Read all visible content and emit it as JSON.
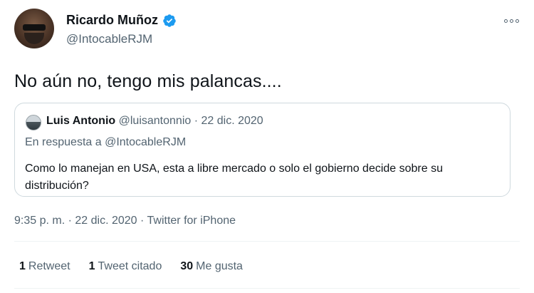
{
  "author": {
    "name": "Ricardo Muñoz",
    "handle": "@IntocableRJM",
    "verified": true
  },
  "tweet": {
    "text": "No aún no, tengo mis palancas...."
  },
  "quoted_tweet": {
    "author_name": "Luis Antonio",
    "author_handle": "@luisantonnio",
    "separator": "·",
    "date": "22 dic. 2020",
    "reply_prefix": "En respuesta a",
    "reply_to": "@IntocableRJM",
    "text": "Como lo manejan en USA, esta a libre mercado o solo el gobierno decide sobre su distribución?"
  },
  "meta": {
    "time": "9:35 p. m.",
    "separator": "·",
    "date": "22 dic. 2020",
    "source": "Twitter for iPhone"
  },
  "stats": [
    {
      "count": "1",
      "label": "Retweet"
    },
    {
      "count": "1",
      "label": "Tweet citado"
    },
    {
      "count": "30",
      "label": "Me gusta"
    }
  ],
  "colors": {
    "verified_blue": "#1d9bf0",
    "secondary_text": "#536471",
    "border": "#cfd9de"
  },
  "icons": {
    "verified": "verified-badge-icon",
    "more": "more-options-icon"
  }
}
